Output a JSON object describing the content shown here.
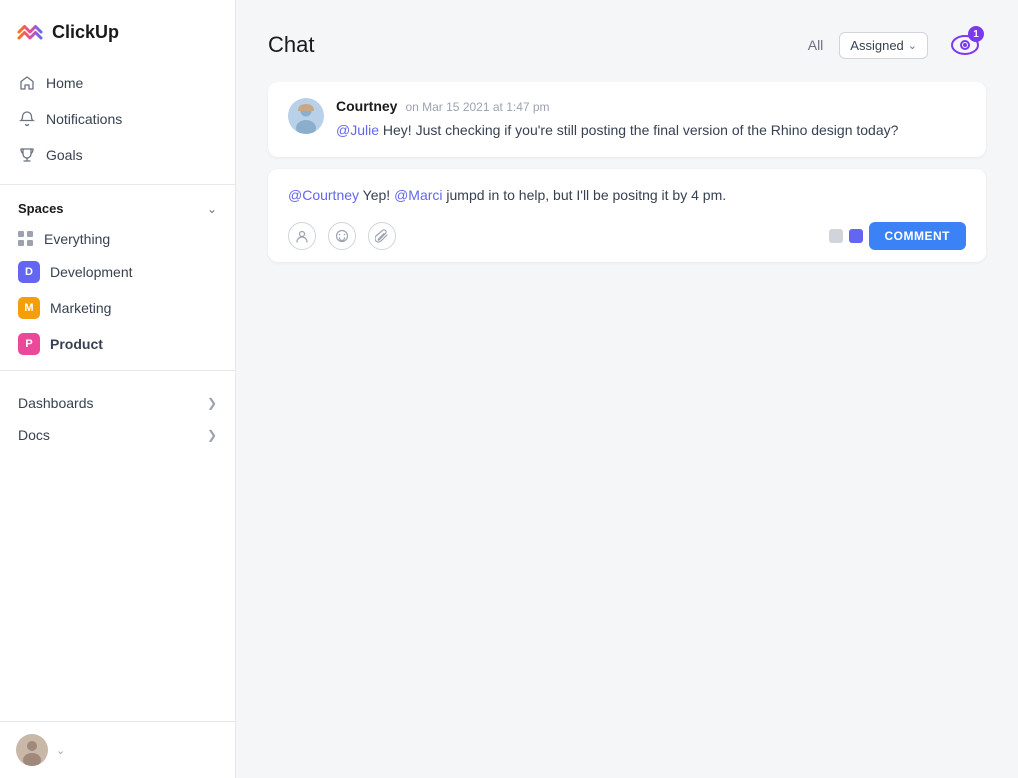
{
  "app": {
    "name": "ClickUp"
  },
  "sidebar": {
    "nav": [
      {
        "id": "home",
        "label": "Home",
        "icon": "home-icon"
      },
      {
        "id": "notifications",
        "label": "Notifications",
        "icon": "bell-icon"
      },
      {
        "id": "goals",
        "label": "Goals",
        "icon": "trophy-icon"
      }
    ],
    "spaces_label": "Spaces",
    "spaces": [
      {
        "id": "everything",
        "label": "Everything",
        "type": "grid"
      },
      {
        "id": "development",
        "label": "Development",
        "type": "badge",
        "color": "#6366f1",
        "letter": "D"
      },
      {
        "id": "marketing",
        "label": "Marketing",
        "type": "badge",
        "color": "#f59e0b",
        "letter": "M"
      },
      {
        "id": "product",
        "label": "Product",
        "type": "badge",
        "color": "#ec4899",
        "letter": "P",
        "active": true
      }
    ],
    "sections": [
      {
        "id": "dashboards",
        "label": "Dashboards"
      },
      {
        "id": "docs",
        "label": "Docs"
      }
    ]
  },
  "chat": {
    "title": "Chat",
    "filter_all": "All",
    "filter_assigned": "Assigned",
    "watch_count": "1",
    "messages": [
      {
        "id": "msg1",
        "author": "Courtney",
        "time": "on Mar 15 2021 at 1:47 pm",
        "text_prefix": "",
        "mention": "@Julie",
        "text_after": " Hey! Just checking if you're still posting the final version of the Rhino design today?"
      }
    ],
    "reply": {
      "mention1": "@Courtney",
      "text_mid1": " Yep! ",
      "mention2": "@Marci",
      "text_mid2": " jumpd in to help, but I'll be positng it by 4 pm."
    },
    "comment_button": "COMMENT"
  }
}
